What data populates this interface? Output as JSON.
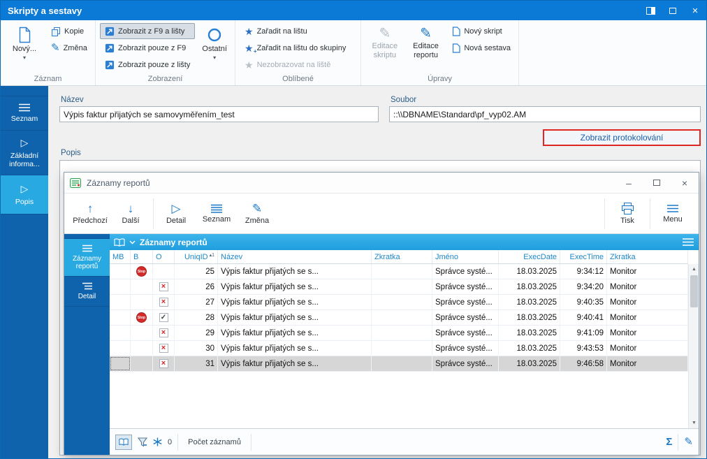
{
  "titlebar": {
    "title": "Skripty a sestavy"
  },
  "ribbon": {
    "groups": {
      "zaznam": {
        "label": "Záznam",
        "novy": "Nový...",
        "kopie": "Kopie",
        "zmena": "Změna"
      },
      "zobrazeni": {
        "label": "Zobrazení",
        "zobrazit_f9_listy": "Zobrazit z F9 a lišty",
        "zobrazit_pouze_f9": "Zobrazit pouze z F9",
        "zobrazit_pouze_listy": "Zobrazit pouze z lišty",
        "ostatni": "Ostatní"
      },
      "oblibene": {
        "label": "Oblíbené",
        "zaradit_na_listu": "Zařadit na lištu",
        "zaradit_do_skupiny": "Zařadit na lištu do skupiny",
        "nezobrazovat": "Nezobrazovat na liště"
      },
      "upravy": {
        "label": "Úpravy",
        "editace_skriptu": "Editace skriptu",
        "editace_reportu": "Editace reportu",
        "novy_skript": "Nový skript",
        "nova_sestava": "Nová sestava"
      }
    }
  },
  "sidebar": {
    "items": [
      {
        "label": "Seznam"
      },
      {
        "label": "Základní informa..."
      },
      {
        "label": "Popis"
      }
    ]
  },
  "form": {
    "nazev_label": "Název",
    "nazev_value": "Výpis faktur přijatých se samovyměřením_test",
    "soubor_label": "Soubor",
    "soubor_value": "::\\\\DBNAME\\Standard\\pf_vyp02.AM",
    "protokol_button": "Zobrazit protokolování",
    "popis_label": "Popis"
  },
  "dialog": {
    "title": "Záznamy reportů",
    "toolbar": {
      "predchozi": "Předchozí",
      "dalsi": "Další",
      "detail": "Detail",
      "seznam": "Seznam",
      "zmena": "Změna",
      "tisk": "Tisk",
      "menu": "Menu"
    },
    "sidebar": [
      {
        "label": "Záznamy reportů"
      },
      {
        "label": "Detail"
      }
    ],
    "grid": {
      "title": "Záznamy reportů",
      "columns": [
        "MB",
        "B",
        "O",
        "UniqID",
        "Název",
        "Zkratka",
        "Jméno",
        "ExecDate",
        "ExecTime",
        "Zkratka"
      ],
      "sort_column_index": 3,
      "sort_order": "1",
      "rows": [
        {
          "b_icon": "stop",
          "o_icon": "",
          "uniqid": "25",
          "nazev": "Výpis faktur přijatých se s...",
          "zkratka": "",
          "jmeno": "Správce systé...",
          "execdate": "18.03.2025",
          "exectime": "9:34:12",
          "zkratka2": "Monitor",
          "selected": false
        },
        {
          "b_icon": "",
          "o_icon": "cross",
          "uniqid": "26",
          "nazev": "Výpis faktur přijatých se s...",
          "zkratka": "",
          "jmeno": "Správce systé...",
          "execdate": "18.03.2025",
          "exectime": "9:34:20",
          "zkratka2": "Monitor",
          "selected": false
        },
        {
          "b_icon": "",
          "o_icon": "cross",
          "uniqid": "27",
          "nazev": "Výpis faktur přijatých se s...",
          "zkratka": "",
          "jmeno": "Správce systé...",
          "execdate": "18.03.2025",
          "exectime": "9:40:35",
          "zkratka2": "Monitor",
          "selected": false
        },
        {
          "b_icon": "stop",
          "o_icon": "check",
          "uniqid": "28",
          "nazev": "Výpis faktur přijatých se s...",
          "zkratka": "",
          "jmeno": "Správce systé...",
          "execdate": "18.03.2025",
          "exectime": "9:40:41",
          "zkratka2": "Monitor",
          "selected": false
        },
        {
          "b_icon": "",
          "o_icon": "cross",
          "uniqid": "29",
          "nazev": "Výpis faktur přijatých se s...",
          "zkratka": "",
          "jmeno": "Správce systé...",
          "execdate": "18.03.2025",
          "exectime": "9:41:09",
          "zkratka2": "Monitor",
          "selected": false
        },
        {
          "b_icon": "",
          "o_icon": "cross",
          "uniqid": "30",
          "nazev": "Výpis faktur přijatých se s...",
          "zkratka": "",
          "jmeno": "Správce systé...",
          "execdate": "18.03.2025",
          "exectime": "9:43:53",
          "zkratka2": "Monitor",
          "selected": false
        },
        {
          "b_icon": "",
          "o_icon": "cross",
          "uniqid": "31",
          "nazev": "Výpis faktur přijatých se s...",
          "zkratka": "",
          "jmeno": "Správce systé...",
          "execdate": "18.03.2025",
          "exectime": "9:46:58",
          "zkratka2": "Monitor",
          "selected": true
        }
      ]
    },
    "statusbar": {
      "filter_count": "0",
      "count_label": "Počet záznamů"
    }
  },
  "icons": {
    "close": "×",
    "minimize": "–",
    "check": "✓",
    "cross": "×",
    "star": "★",
    "plus": "+",
    "pencil": "✎",
    "caret_down": "▾",
    "arrow_up": "↑",
    "arrow_down": "↓",
    "detail_triangle": "▷",
    "sigma": "Σ",
    "sort_asc": "▴",
    "scroll_up": "▲",
    "scroll_down": "▼",
    "stop_label": "Stop"
  },
  "colors": {
    "titlebar_blue": "#0a7ad6",
    "sidebar_blue": "#0f63ad",
    "selected_cyan": "#29a9e1",
    "grid_header_cyan": "#2faae3",
    "accent_blue": "#1a78c8",
    "alert_red": "#e02525",
    "stop_red": "#d42a2a"
  }
}
